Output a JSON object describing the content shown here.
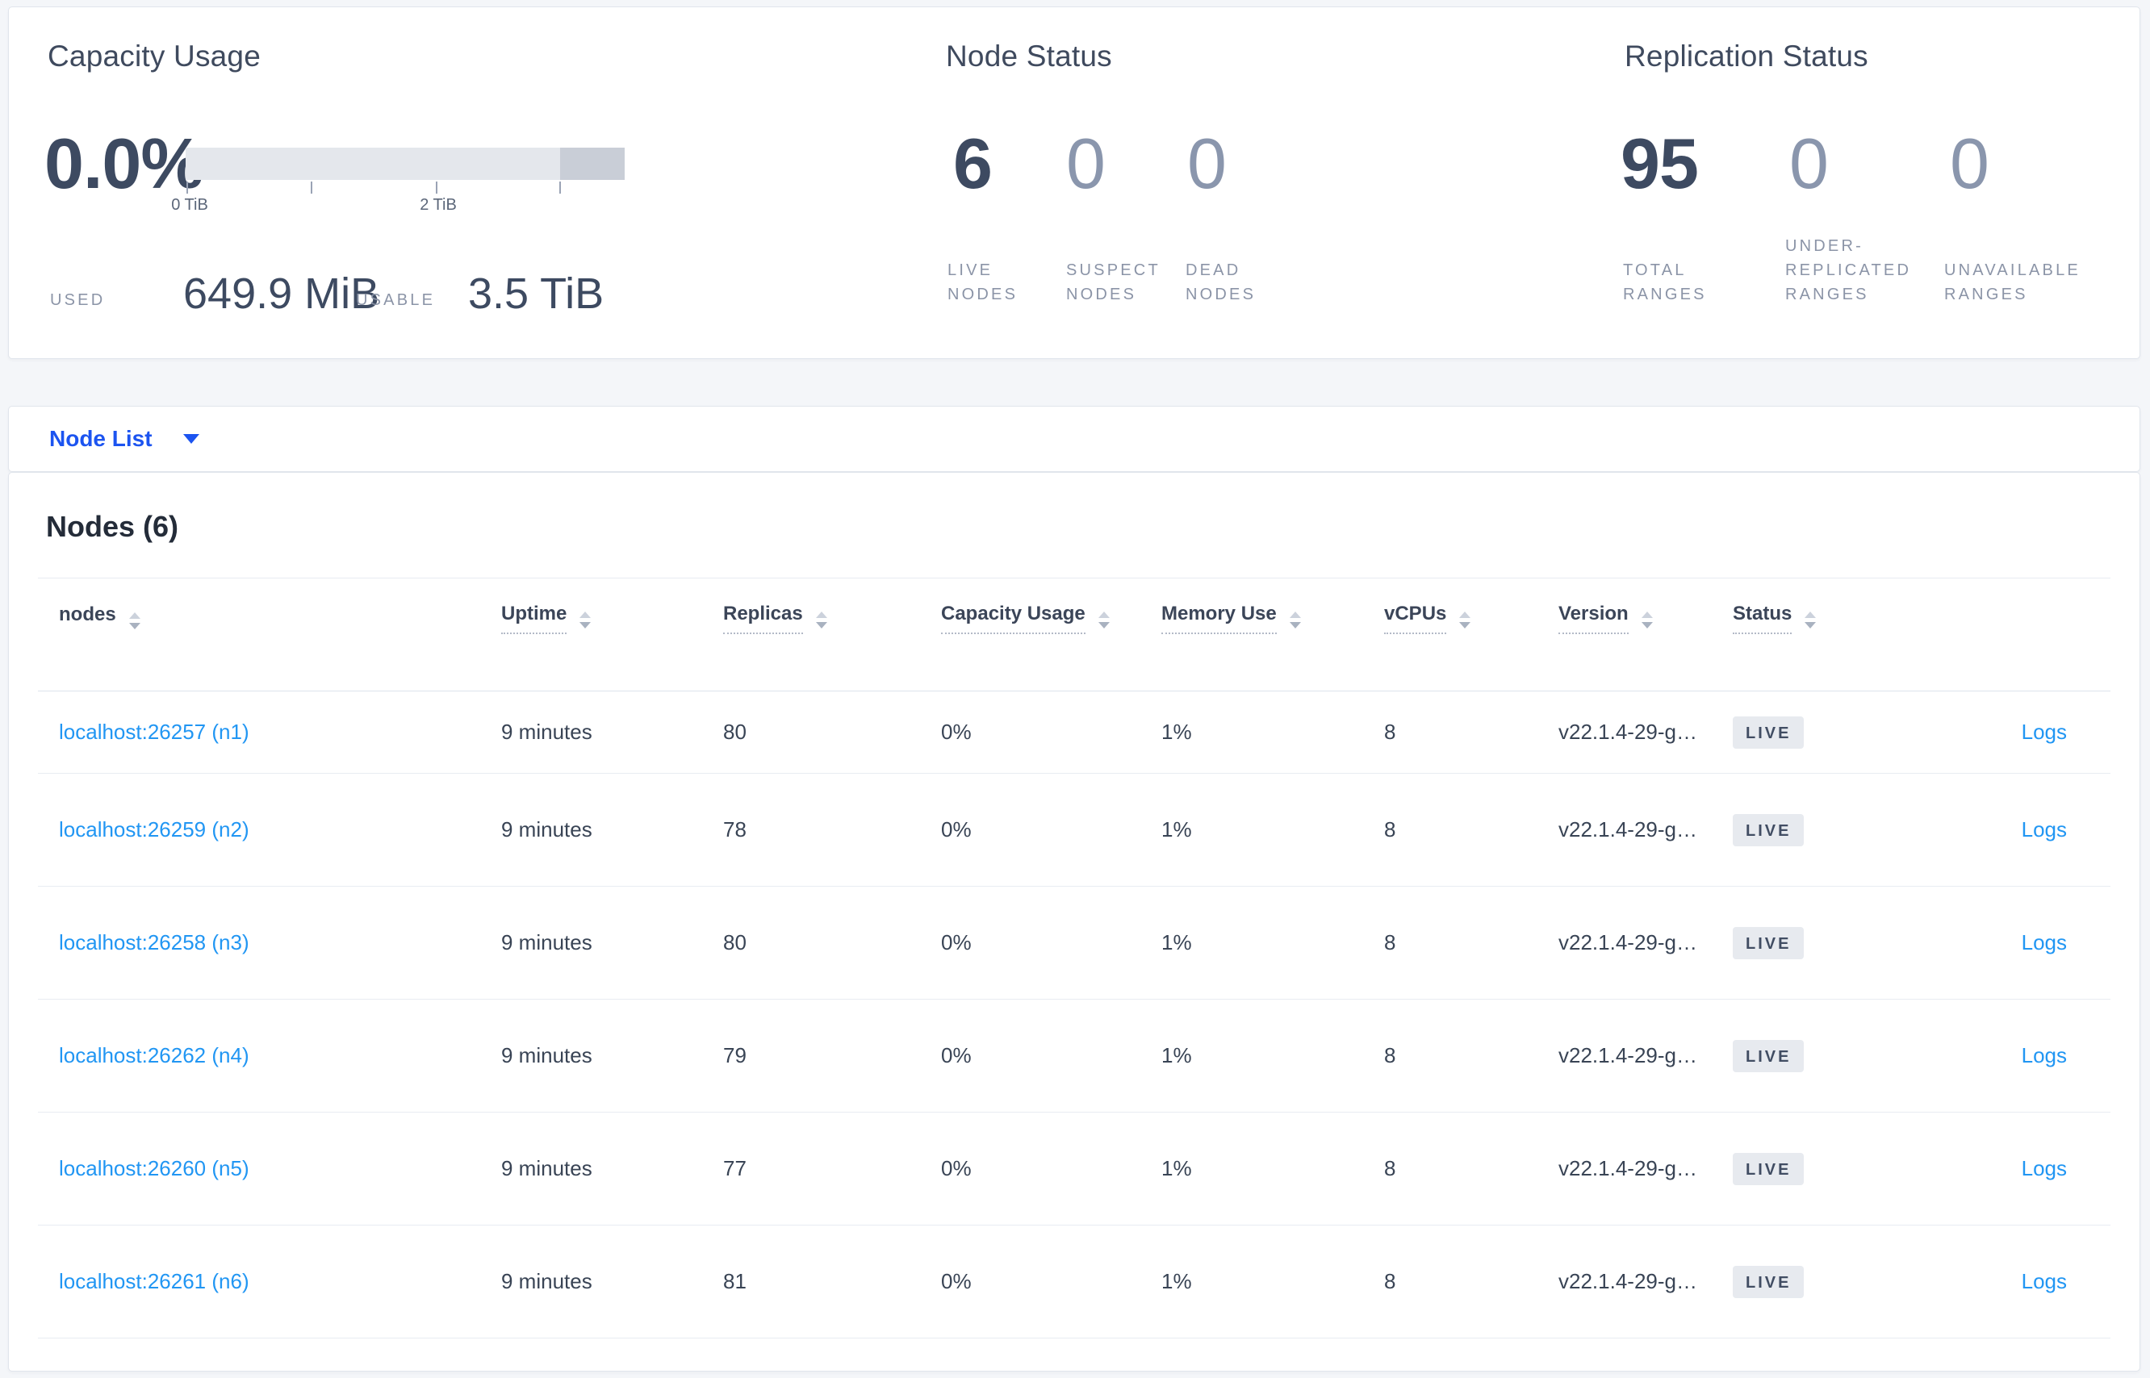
{
  "colors": {
    "page_bg": "#f4f6f9",
    "link_blue": "#2196f3",
    "selector_blue": "#1c54f0",
    "badge_bg": "#e7eaef",
    "bar_track": "#e4e7ec",
    "bar_segment": "#c9ced7"
  },
  "summary": {
    "capacity": {
      "title": "Capacity Usage",
      "percent": "0.0%",
      "tick_labels": [
        "0 TiB",
        "2 TiB"
      ],
      "used_label": "USED",
      "used_value": "649.9 MiB",
      "usable_label": "USABLE",
      "usable_value": "3.5 TiB"
    },
    "node_status": {
      "title": "Node Status",
      "stats": [
        {
          "value": "6",
          "label": "LIVE NODES"
        },
        {
          "value": "0",
          "label": "SUSPECT NODES"
        },
        {
          "value": "0",
          "label": "DEAD NODES"
        }
      ]
    },
    "replication": {
      "title": "Replication Status",
      "stats": [
        {
          "value": "95",
          "label": "TOTAL RANGES"
        },
        {
          "value": "0",
          "label": "UNDER-REPLICATED RANGES"
        },
        {
          "value": "0",
          "label": "UNAVAILABLE RANGES"
        }
      ]
    }
  },
  "view_selector": {
    "label": "Node List",
    "caret_icon": "caret-down-icon"
  },
  "nodes_section": {
    "heading": "Nodes (6)",
    "columns": [
      {
        "key": "node",
        "label": "nodes",
        "dotted": false
      },
      {
        "key": "uptime",
        "label": "Uptime",
        "dotted": true
      },
      {
        "key": "replicas",
        "label": "Replicas",
        "dotted": true
      },
      {
        "key": "capacity_usage",
        "label": "Capacity Usage",
        "dotted": true
      },
      {
        "key": "memory_use",
        "label": "Memory Use",
        "dotted": true
      },
      {
        "key": "vcpus",
        "label": "vCPUs",
        "dotted": true
      },
      {
        "key": "version",
        "label": "Version",
        "dotted": true
      },
      {
        "key": "status",
        "label": "Status",
        "dotted": true
      },
      {
        "key": "logs",
        "label": "",
        "dotted": false
      }
    ],
    "rows": [
      {
        "node": "localhost:26257 (n1)",
        "uptime": "9 minutes",
        "replicas": "80",
        "capacity_usage": "0%",
        "memory_use": "1%",
        "vcpus": "8",
        "version": "v22.1.4-29-g…",
        "status": "LIVE",
        "logs": "Logs"
      },
      {
        "node": "localhost:26259 (n2)",
        "uptime": "9 minutes",
        "replicas": "78",
        "capacity_usage": "0%",
        "memory_use": "1%",
        "vcpus": "8",
        "version": "v22.1.4-29-g…",
        "status": "LIVE",
        "logs": "Logs"
      },
      {
        "node": "localhost:26258 (n3)",
        "uptime": "9 minutes",
        "replicas": "80",
        "capacity_usage": "0%",
        "memory_use": "1%",
        "vcpus": "8",
        "version": "v22.1.4-29-g…",
        "status": "LIVE",
        "logs": "Logs"
      },
      {
        "node": "localhost:26262 (n4)",
        "uptime": "9 minutes",
        "replicas": "79",
        "capacity_usage": "0%",
        "memory_use": "1%",
        "vcpus": "8",
        "version": "v22.1.4-29-g…",
        "status": "LIVE",
        "logs": "Logs"
      },
      {
        "node": "localhost:26260 (n5)",
        "uptime": "9 minutes",
        "replicas": "77",
        "capacity_usage": "0%",
        "memory_use": "1%",
        "vcpus": "8",
        "version": "v22.1.4-29-g…",
        "status": "LIVE",
        "logs": "Logs"
      },
      {
        "node": "localhost:26261 (n6)",
        "uptime": "9 minutes",
        "replicas": "81",
        "capacity_usage": "0%",
        "memory_use": "1%",
        "vcpus": "8",
        "version": "v22.1.4-29-g…",
        "status": "LIVE",
        "logs": "Logs"
      }
    ]
  }
}
